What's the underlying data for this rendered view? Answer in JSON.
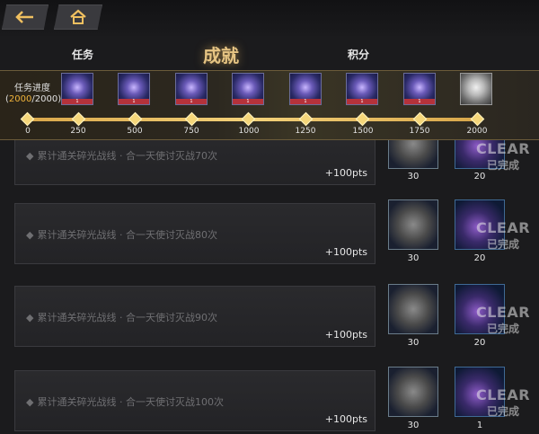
{
  "topbar": {
    "back_icon": "back-arrow-icon",
    "home_icon": "home-icon"
  },
  "tabs": [
    {
      "label": "任务",
      "active": false
    },
    {
      "label": "成就",
      "active": true
    },
    {
      "label": "积分",
      "active": false
    }
  ],
  "progress": {
    "label": "任务进度",
    "current": "2000",
    "total": "/2000",
    "open_paren": "(",
    "close_paren": ")",
    "milestones": [
      "0",
      "250",
      "500",
      "750",
      "1000",
      "1250",
      "1500",
      "1750",
      "2000"
    ],
    "reward_badge": "1"
  },
  "tasks": [
    {
      "text": "累计通关碎光战线 · 合一天使讨灭战70次",
      "pts": "+100pts",
      "rewards": [
        "30",
        "20"
      ],
      "status_en": "CLEAR",
      "status_cn": "已完成"
    },
    {
      "text": "累计通关碎光战线 · 合一天使讨灭战80次",
      "pts": "+100pts",
      "rewards": [
        "30",
        "20"
      ],
      "status_en": "CLEAR",
      "status_cn": "已完成"
    },
    {
      "text": "累计通关碎光战线 · 合一天使讨灭战90次",
      "pts": "+100pts",
      "rewards": [
        "30",
        "20"
      ],
      "status_en": "CLEAR",
      "status_cn": "已完成"
    },
    {
      "text": "累计通关碎光战线 · 合一天使讨灭战100次",
      "pts": "+100pts",
      "rewards": [
        "30",
        "1"
      ],
      "status_en": "CLEAR",
      "status_cn": "已完成"
    }
  ],
  "colors": {
    "accent": "#e6c483",
    "progress_current": "#f0b33a",
    "track": "#f4d27a"
  }
}
